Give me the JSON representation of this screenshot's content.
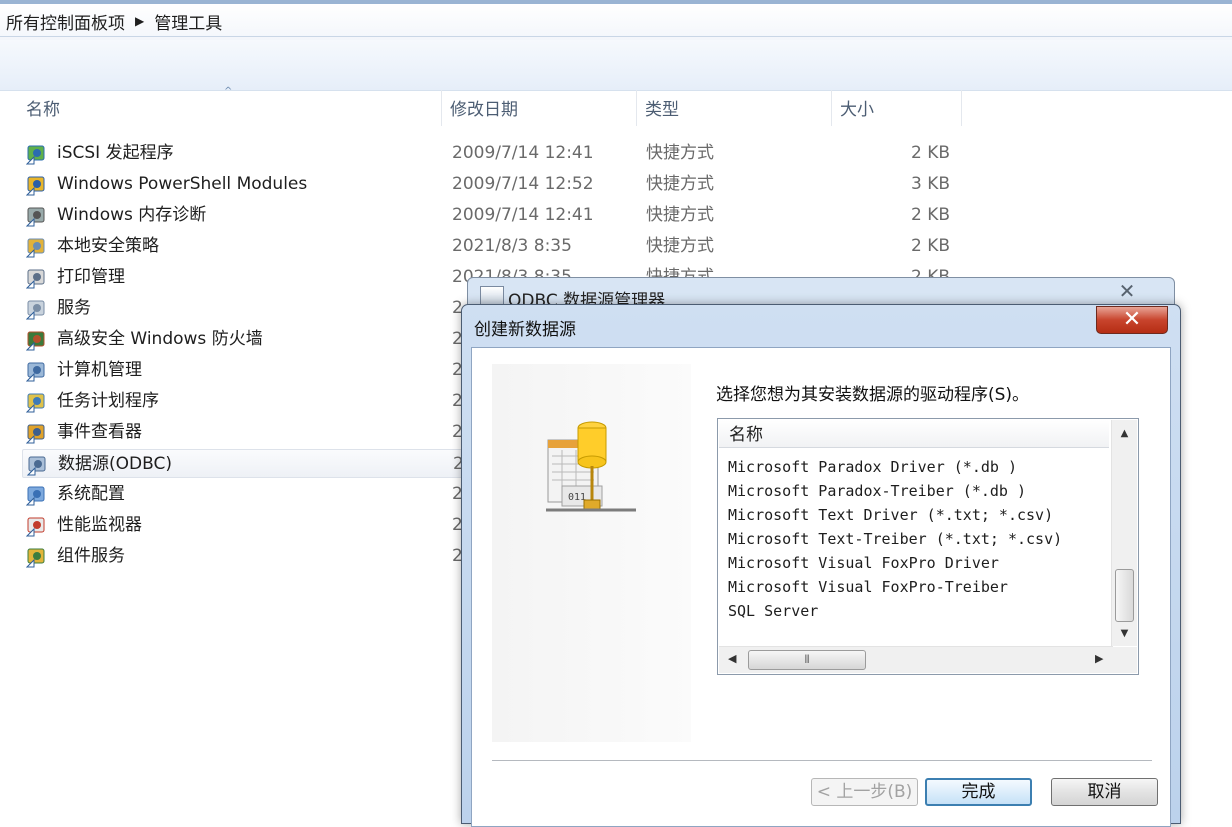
{
  "breadcrumb": {
    "root": "所有控制面板项",
    "current": "管理工具"
  },
  "columns": {
    "name": "名称",
    "modified": "修改日期",
    "type": "类型",
    "size": "大小"
  },
  "files": [
    {
      "name": "iSCSI 发起程序",
      "date": "2009/7/14 12:41",
      "type": "快捷方式",
      "size": "2 KB",
      "icon": "iscsi-icon"
    },
    {
      "name": "Windows PowerShell Modules",
      "date": "2009/7/14 12:52",
      "type": "快捷方式",
      "size": "3 KB",
      "icon": "powershell-icon"
    },
    {
      "name": "Windows 内存诊断",
      "date": "2009/7/14 12:41",
      "type": "快捷方式",
      "size": "2 KB",
      "icon": "memory-diagnostic-icon"
    },
    {
      "name": "本地安全策略",
      "date": "2021/8/3 8:35",
      "type": "快捷方式",
      "size": "2 KB",
      "icon": "security-policy-icon"
    },
    {
      "name": "打印管理",
      "date": "2021/8/3 8:35",
      "type": "快捷方式",
      "size": "2 KB",
      "icon": "print-management-icon"
    },
    {
      "name": "服务",
      "date": "2",
      "type": "",
      "size": "",
      "icon": "services-icon"
    },
    {
      "name": "高级安全 Windows 防火墙",
      "date": "2",
      "type": "",
      "size": "",
      "icon": "firewall-icon"
    },
    {
      "name": "计算机管理",
      "date": "2",
      "type": "",
      "size": "",
      "icon": "computer-management-icon"
    },
    {
      "name": "任务计划程序",
      "date": "2",
      "type": "",
      "size": "",
      "icon": "task-scheduler-icon"
    },
    {
      "name": "事件查看器",
      "date": "2",
      "type": "",
      "size": "",
      "icon": "event-viewer-icon"
    },
    {
      "name": "数据源(ODBC)",
      "date": "2",
      "type": "",
      "size": "",
      "icon": "odbc-icon",
      "selected": true
    },
    {
      "name": "系统配置",
      "date": "2",
      "type": "",
      "size": "",
      "icon": "system-config-icon"
    },
    {
      "name": "性能监视器",
      "date": "2",
      "type": "",
      "size": "",
      "icon": "performance-monitor-icon"
    },
    {
      "name": "组件服务",
      "date": "2",
      "type": "",
      "size": "",
      "icon": "component-services-icon"
    }
  ],
  "back_dialog": {
    "title": "ODBC 数据源管理器",
    "close": "✕"
  },
  "dialog": {
    "title": "创建新数据源",
    "close": "✕",
    "prompt": "选择您想为其安装数据源的驱动程序(S)。",
    "list_header": "名称",
    "drivers": [
      "Microsoft Paradox Driver (*.db )",
      "Microsoft Paradox-Treiber (*.db )",
      "Microsoft Text Driver (*.txt; *.csv)",
      "Microsoft Text-Treiber (*.txt; *.csv)",
      "Microsoft Visual FoxPro Driver",
      "Microsoft Visual FoxPro-Treiber",
      "SQL Server"
    ],
    "back_button": "< 上一步(B)",
    "finish_button": "完成",
    "cancel_button": "取消"
  },
  "colors": {
    "accent": "#3c7fb1",
    "close_red": "#c8442d",
    "titlebar": "#cfdff2"
  }
}
